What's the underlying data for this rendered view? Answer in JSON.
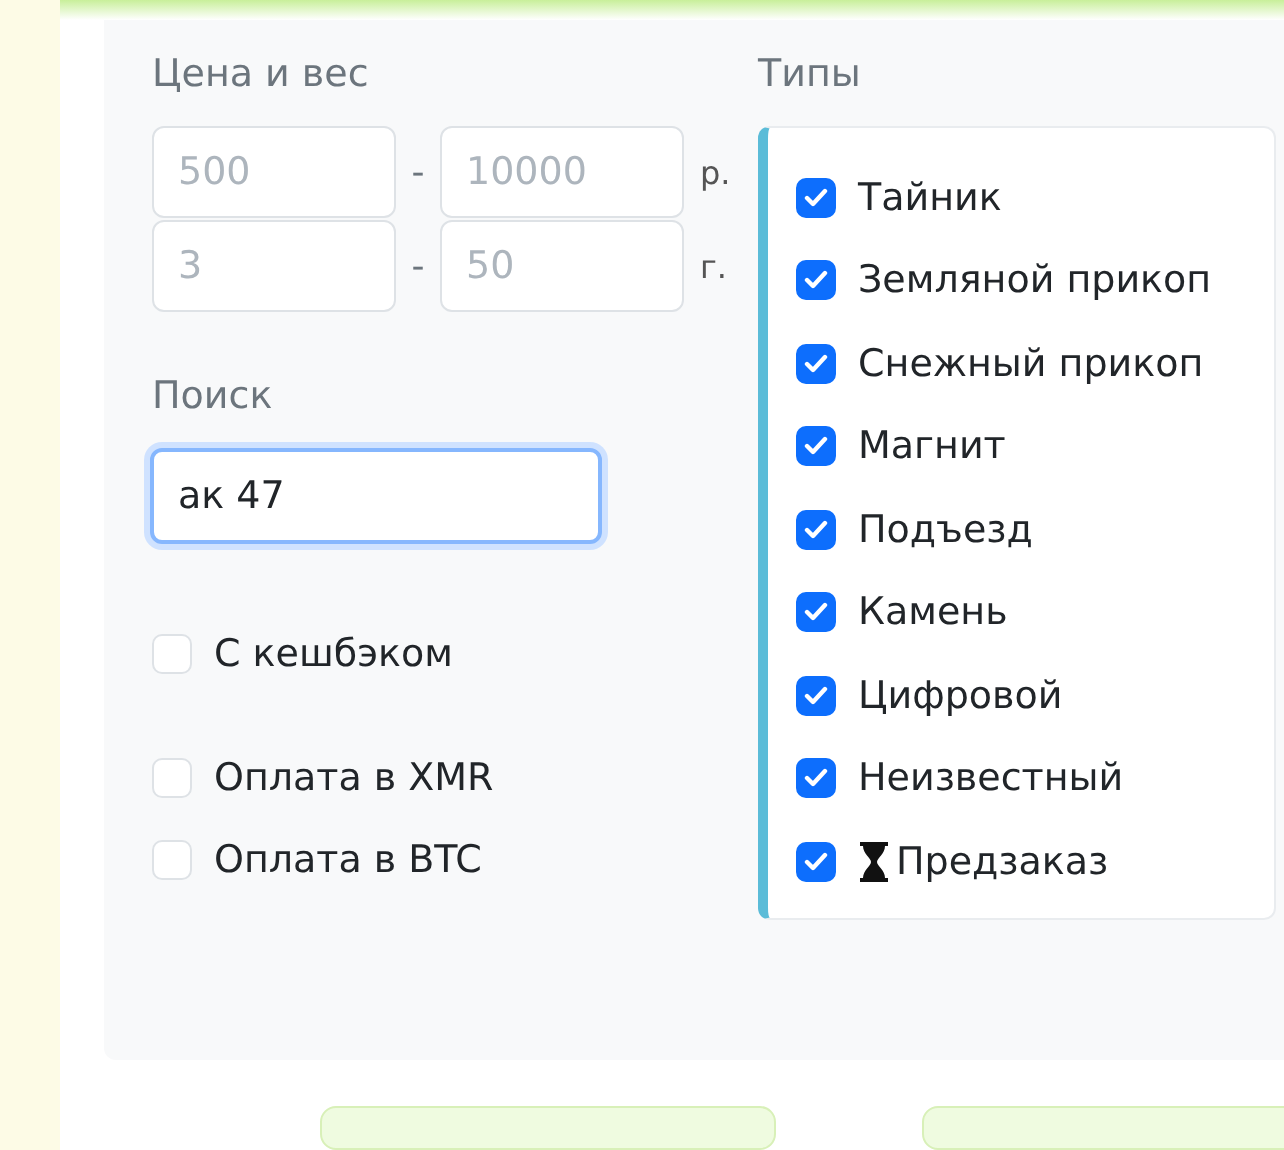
{
  "price_weight": {
    "title": "Цена и вес",
    "ranges": [
      {
        "from_placeholder": "500",
        "to_placeholder": "10000",
        "separator": "-",
        "unit": "р."
      },
      {
        "from_placeholder": "3",
        "to_placeholder": "50",
        "separator": "-",
        "unit": "г."
      }
    ]
  },
  "search": {
    "title": "Поиск",
    "value": "ак 47"
  },
  "options": [
    {
      "label": "С кешбэком",
      "checked": false
    },
    {
      "label": "Оплата в XMR",
      "checked": false
    },
    {
      "label": "Оплата в BTC",
      "checked": false
    }
  ],
  "types": {
    "title": "Типы",
    "items": [
      {
        "label": "Тайник",
        "checked": true,
        "kind": "plain"
      },
      {
        "label": "Земляной прикоп",
        "checked": true,
        "kind": "plain"
      },
      {
        "label": "Снежный прикоп",
        "checked": true,
        "kind": "plain"
      },
      {
        "label": "Магнит",
        "checked": true,
        "kind": "plain"
      },
      {
        "label": "Подъезд",
        "checked": true,
        "kind": "plain"
      },
      {
        "label": "Камень",
        "checked": true,
        "kind": "plain"
      },
      {
        "label": "Цифровой",
        "checked": true,
        "kind": "plain"
      },
      {
        "label": "Неизвестный",
        "checked": true,
        "kind": "plain"
      },
      {
        "label": "Предзаказ",
        "checked": true,
        "kind": "hourglass"
      }
    ]
  }
}
